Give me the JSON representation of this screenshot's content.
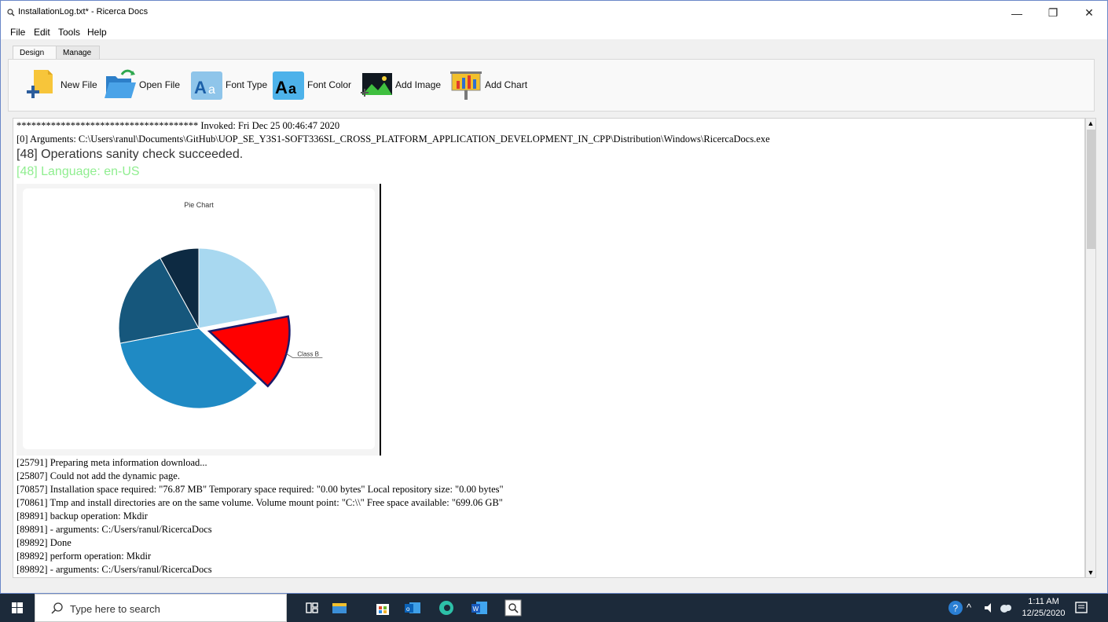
{
  "window": {
    "title": "InstallationLog.txt* - Ricerca Docs",
    "controls": [
      "—",
      "❐",
      "✕"
    ]
  },
  "menu": [
    "File",
    "Edit",
    "Tools",
    "Help"
  ],
  "ribbon": {
    "tabs": [
      "Design",
      "Manage"
    ],
    "buttons": [
      "New File",
      "Open File",
      "Font Type",
      "Font Color",
      "Add Image",
      "Add Chart"
    ]
  },
  "document": {
    "header_lines": [
      "************************************* Invoked: Fri Dec 25 00:46:47 2020",
      "[0] Arguments: C:\\Users\\ranul\\Documents\\GitHub\\UOP_SE_Y3S1-SOFT336SL_CROSS_PLATFORM_APPLICATION_DEVELOPMENT_IN_CPP\\Distribution\\Windows\\RicercaDocs.exe"
    ],
    "sanity": "[48] Operations sanity check succeeded.",
    "language": "[48] Language: en-US",
    "log_lines": [
      "[25791] Preparing meta information download...",
      "[25807] Could not add the dynamic page.",
      "[70857] Installation space required: \"76.87 MB\" Temporary space required: \"0.00 bytes\" Local repository size: \"0.00 bytes\"",
      "[70861] Tmp and install directories are on the same volume. Volume mount point: \"C:\\\\\" Free space available: \"699.06 GB\"",
      "[89891] backup  operation: Mkdir",
      "[89891]   - arguments: C:/Users/ranul/RicercaDocs",
      "[89892] Done",
      "[89892] perform  operation: Mkdir",
      "[89892]   - arguments: C:/Users/ranul/RicercaDocs"
    ]
  },
  "chart_data": {
    "type": "pie",
    "title": "Pie Chart",
    "slices": [
      {
        "label": "",
        "value": 22,
        "color": "#a8d8f0"
      },
      {
        "label": "Class B",
        "value": 15,
        "color": "#ff0000",
        "exploded": true
      },
      {
        "label": "",
        "value": 35,
        "color": "#1f8ac4"
      },
      {
        "label": "",
        "value": 20,
        "color": "#16577c"
      },
      {
        "label": "",
        "value": 8,
        "color": "#0d2a42"
      }
    ]
  },
  "taskbar": {
    "search_placeholder": "Type here to search",
    "time": "1:11 AM",
    "date": "12/25/2020"
  }
}
